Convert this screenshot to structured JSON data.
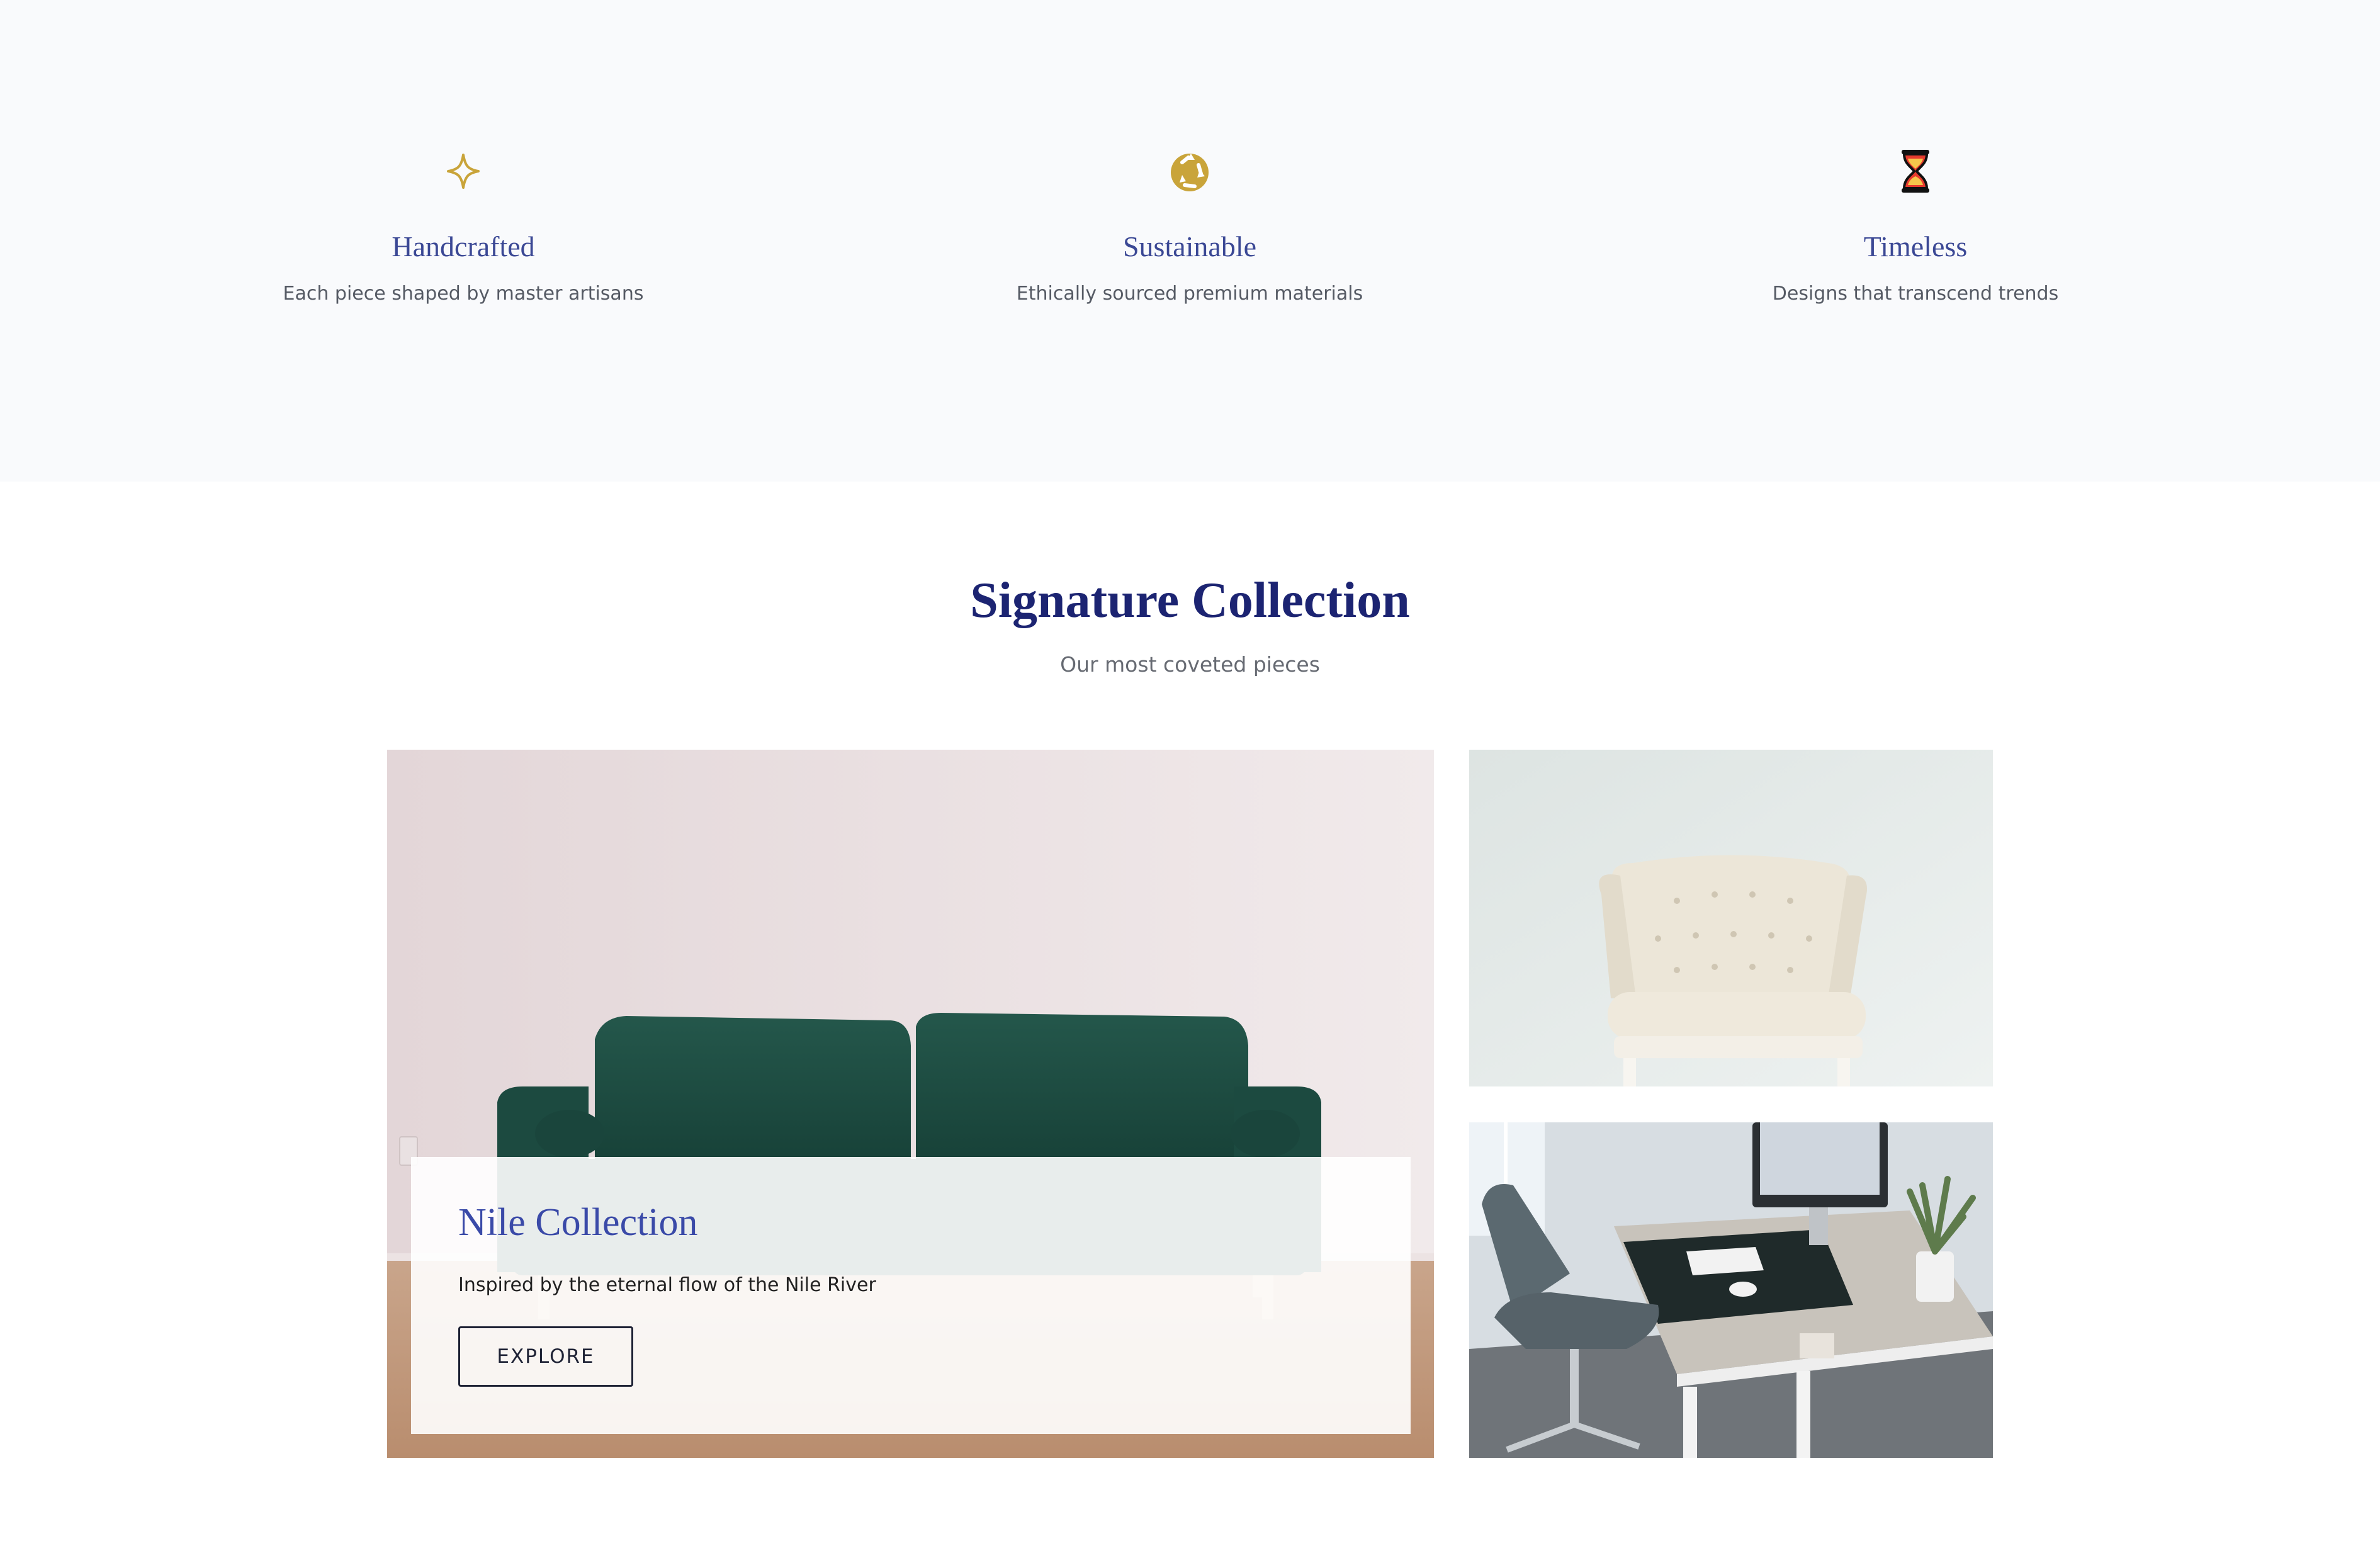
{
  "features": [
    {
      "icon": "sparkle-icon",
      "title": "Handcrafted",
      "desc": "Each piece shaped by master artisans"
    },
    {
      "icon": "recycle-icon",
      "title": "Sustainable",
      "desc": "Ethically sourced premium materials"
    },
    {
      "icon": "hourglass-icon",
      "title": "Timeless",
      "desc": "Designs that transcend trends"
    }
  ],
  "collection": {
    "title": "Signature Collection",
    "subtitle": "Our most coveted pieces",
    "featured": {
      "title": "Nile Collection",
      "desc": "Inspired by the eternal flow of the Nile River",
      "button": "EXPLORE"
    }
  },
  "colors": {
    "gold": "#c9a43a",
    "navy": "#1c2472",
    "feature_title": "#3b4895",
    "sofa_green": "#1f4f45"
  }
}
